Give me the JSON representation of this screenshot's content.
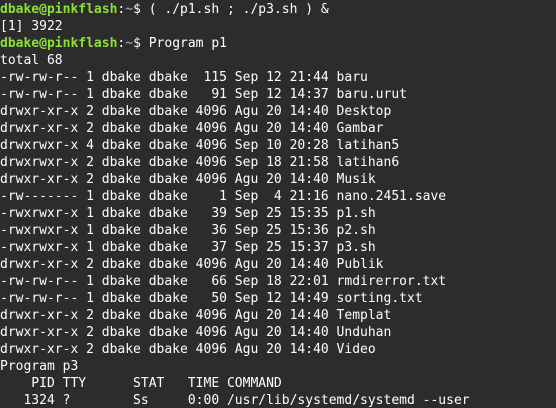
{
  "prompt": {
    "user_host": "dbake@pinkflash",
    "path": "~",
    "symbol": "$"
  },
  "lines": [
    {
      "type": "prompt",
      "command": " ( ./p1.sh ; ./p3.sh ) &"
    },
    {
      "type": "output",
      "text": "[1] 3922"
    },
    {
      "type": "prompt",
      "command": " Program p1"
    },
    {
      "type": "output",
      "text": "total 68"
    },
    {
      "type": "output",
      "text": "-rw-rw-r-- 1 dbake dbake  115 Sep 12 21:44 baru"
    },
    {
      "type": "output",
      "text": "-rw-rw-r-- 1 dbake dbake   91 Sep 12 14:37 baru.urut"
    },
    {
      "type": "output",
      "text": "drwxr-xr-x 2 dbake dbake 4096 Agu 20 14:40 Desktop"
    },
    {
      "type": "output",
      "text": "drwxr-xr-x 2 dbake dbake 4096 Agu 20 14:40 Gambar"
    },
    {
      "type": "output",
      "text": "drwxrwxr-x 4 dbake dbake 4096 Sep 10 20:28 latihan5"
    },
    {
      "type": "output",
      "text": "drwxrwxr-x 2 dbake dbake 4096 Sep 18 21:58 latihan6"
    },
    {
      "type": "output",
      "text": "drwxr-xr-x 2 dbake dbake 4096 Agu 20 14:40 Musik"
    },
    {
      "type": "output",
      "text": "-rw------- 1 dbake dbake    1 Sep  4 21:16 nano.2451.save"
    },
    {
      "type": "output",
      "text": "-rwxrwxr-x 1 dbake dbake   39 Sep 25 15:35 p1.sh"
    },
    {
      "type": "output",
      "text": "-rwxrwxr-x 1 dbake dbake   36 Sep 25 15:36 p2.sh"
    },
    {
      "type": "output",
      "text": "-rwxrwxr-x 1 dbake dbake   37 Sep 25 15:37 p3.sh"
    },
    {
      "type": "output",
      "text": "drwxr-xr-x 2 dbake dbake 4096 Agu 20 14:40 Publik"
    },
    {
      "type": "output",
      "text": "-rw-rw-r-- 1 dbake dbake   66 Sep 18 22:01 rmdirerror.txt"
    },
    {
      "type": "output",
      "text": "-rw-rw-r-- 1 dbake dbake   50 Sep 12 14:49 sorting.txt"
    },
    {
      "type": "output",
      "text": "drwxr-xr-x 2 dbake dbake 4096 Agu 20 14:40 Templat"
    },
    {
      "type": "output",
      "text": "drwxr-xr-x 2 dbake dbake 4096 Agu 20 14:40 Unduhan"
    },
    {
      "type": "output",
      "text": "drwxr-xr-x 2 dbake dbake 4096 Agu 20 14:40 Video"
    },
    {
      "type": "output",
      "text": "Program p3"
    },
    {
      "type": "output",
      "text": "    PID TTY      STAT   TIME COMMAND"
    },
    {
      "type": "output",
      "text": "   1324 ?        Ss     0:00 /usr/lib/systemd/systemd --user"
    }
  ],
  "colors": {
    "background": "#2c2c2c",
    "prompt_user": "#8ae234",
    "prompt_path": "#729fcf",
    "text": "#ffffff"
  }
}
